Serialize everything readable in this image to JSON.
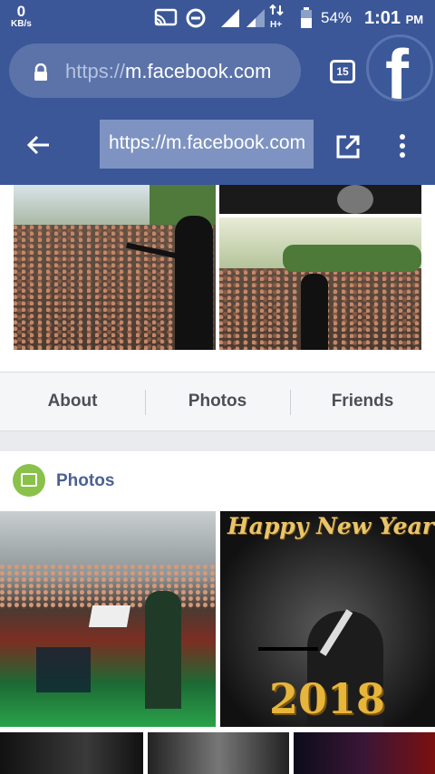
{
  "status_bar": {
    "net_speed_value": "0",
    "net_speed_unit": "KB/s",
    "battery": "54%",
    "time": "1:01",
    "ampm": "PM",
    "icons": [
      "cast-icon",
      "data-saver-icon",
      "signal-icon",
      "signal-icon-2",
      "data-arrows-icon",
      "battery-icon"
    ]
  },
  "browser": {
    "url_prefix": "https://",
    "url_domain": "m.facebook.com",
    "tab_count": "15",
    "app_logo": "f"
  },
  "toolbar": {
    "url": "https://m.facebook.com"
  },
  "profile_tabs": [
    "About",
    "Photos",
    "Friends"
  ],
  "photos_section": {
    "title": "Photos",
    "new_year_text": "Happy New Year",
    "new_year_number": "2018"
  },
  "colors": {
    "facebook_blue": "#3b5798",
    "photos_icon_green": "#8ac14a",
    "section_title": "#4b6195"
  }
}
